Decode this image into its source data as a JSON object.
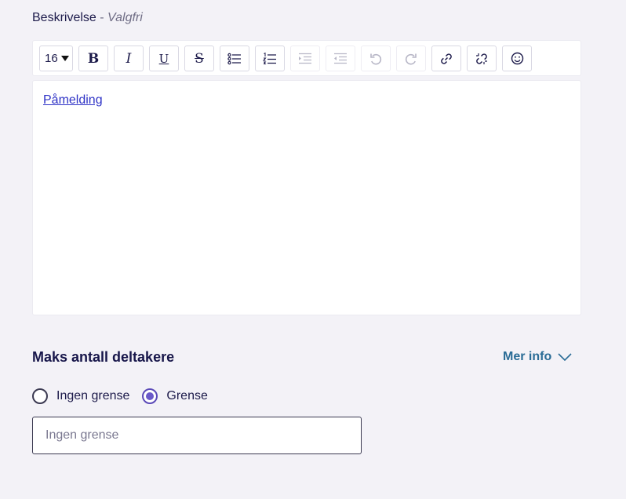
{
  "description": {
    "label": "Beskrivelse",
    "separator": "-",
    "optional": "Valgfri"
  },
  "toolbar": {
    "font_size": "16",
    "buttons": [
      {
        "icon": "bold-icon",
        "label": "B",
        "enabled": true
      },
      {
        "icon": "italic-icon",
        "label": "I",
        "enabled": true
      },
      {
        "icon": "underline-icon",
        "label": "U",
        "enabled": true
      },
      {
        "icon": "strikethrough-icon",
        "label": "S",
        "enabled": true
      },
      {
        "icon": "bullet-list-icon",
        "enabled": true
      },
      {
        "icon": "numbered-list-icon",
        "enabled": true
      },
      {
        "icon": "indent-icon",
        "enabled": false
      },
      {
        "icon": "outdent-icon",
        "enabled": false
      },
      {
        "icon": "undo-icon",
        "enabled": false
      },
      {
        "icon": "redo-icon",
        "enabled": false
      },
      {
        "icon": "link-icon",
        "enabled": true
      },
      {
        "icon": "unlink-icon",
        "enabled": true
      },
      {
        "icon": "emoji-icon",
        "enabled": true
      }
    ]
  },
  "editor": {
    "link_text": "Påmelding"
  },
  "max_participants": {
    "title": "Maks antall deltakere",
    "more_info": "Mer info",
    "options": [
      {
        "label": "Ingen grense",
        "selected": false
      },
      {
        "label": "Grense",
        "selected": true
      }
    ],
    "input_placeholder": "Ingen grense",
    "input_value": ""
  },
  "colors": {
    "background": "#f3f2f7",
    "link": "#2f33c6",
    "accent": "#6a59c9",
    "info_link": "#2a6c96",
    "heading": "#17164a"
  }
}
